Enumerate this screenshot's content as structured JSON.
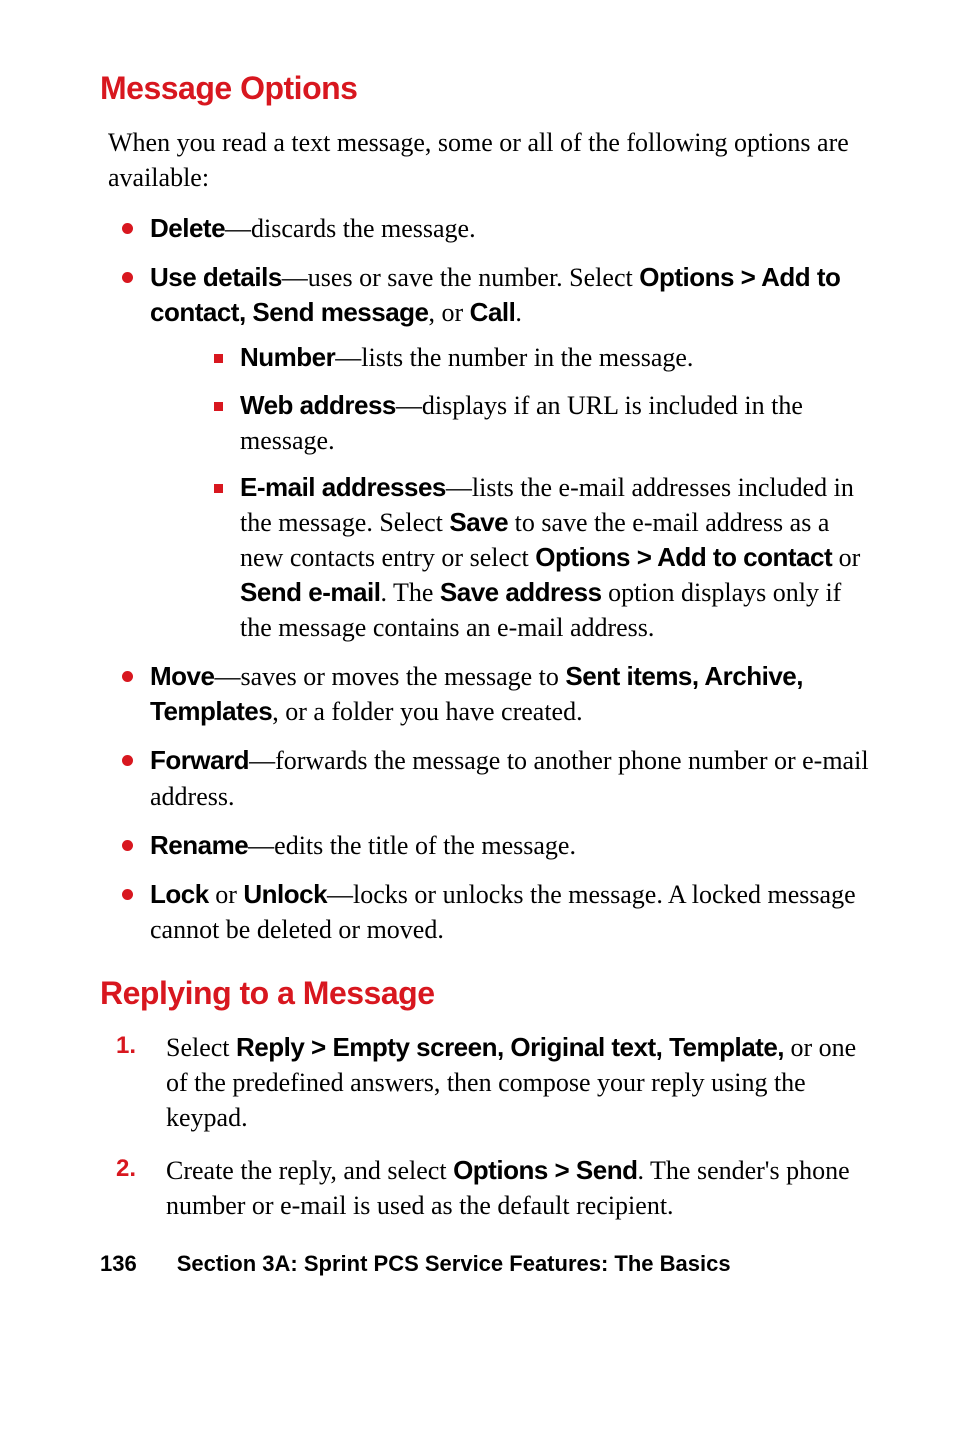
{
  "headings": {
    "h1": "Message Options",
    "h2": "Replying to a Message"
  },
  "intro": "When you read a text message, some or all of the following options are available:",
  "bullets": {
    "delete": {
      "term": "Delete",
      "desc": "—discards the message."
    },
    "usedetails": {
      "term": "Use details",
      "desc_start": "—uses or save the number. Select ",
      "opt_b": "Options > Add to contact, Send message",
      "desc_mid": ", or ",
      "opt_call": "Call",
      "desc_end": "."
    },
    "number": {
      "term": "Number",
      "desc": "—lists the number in the message."
    },
    "web": {
      "term": "Web address",
      "desc": "—displays if an URL is included in the message."
    },
    "email": {
      "term": "E-mail addresses",
      "desc_start": "—lists the e-mail addresses included in the message. Select ",
      "save_b": "Save",
      "desc_mid1": " to save the e-mail address as a new contacts entry or select ",
      "opt_b": "Options > Add to contact",
      "or_text": " or ",
      "send_b": "Send e-mail",
      "desc_mid2": ". The ",
      "saveaddr_b": "Save address",
      "desc_end": " option displays only if the message contains an e-mail address."
    },
    "move": {
      "term": "Move",
      "desc_start": "—saves or moves the message to ",
      "dest_b": "Sent items, Archive, Templates",
      "desc_end": ", or a folder you have created."
    },
    "forward": {
      "term": "Forward",
      "desc": "—forwards the message to another phone number or e-mail address."
    },
    "rename": {
      "term": "Rename",
      "desc": "—edits the title of the message."
    },
    "lock": {
      "term_a": "Lock",
      "or_text": " or ",
      "term_b": "Unlock",
      "desc": "—locks or unlocks the message. A locked message cannot be deleted or moved."
    }
  },
  "steps": {
    "s1": {
      "pre": "Select ",
      "b": "Reply > Empty screen, Original text, Template,",
      "post": " or one of the predefined answers, then compose your reply using the keypad."
    },
    "s2": {
      "pre": "Create the reply, and select ",
      "b": "Options > Send",
      "post": ". The sender's phone number or e-mail is used as the default recipient."
    }
  },
  "footer": {
    "page": "136",
    "section": "Section 3A: Sprint PCS Service Features: The Basics"
  }
}
